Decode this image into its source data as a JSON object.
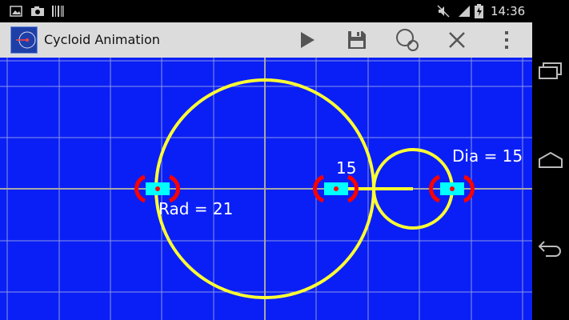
{
  "status_bar": {
    "time": "14:36",
    "icons": [
      "image-icon",
      "camera-icon",
      "barcode-icon",
      "mute-icon",
      "signal-icon",
      "battery-charging-icon"
    ]
  },
  "action_bar": {
    "title": "Cycloid Animation",
    "actions": [
      "play-icon",
      "save-icon",
      "circles-icon",
      "close-icon",
      "overflow-menu-icon"
    ]
  },
  "canvas": {
    "background": "#0a1ff5",
    "circle_color": "#ffff33",
    "handle_color": "#00ffff",
    "marker_color": "#ff0000",
    "labels": {
      "radius": "Rad = 21",
      "diameter": "Dia = 15",
      "arm": "15"
    }
  },
  "nav_bar": {
    "buttons": [
      "recent-apps-icon",
      "home-icon",
      "back-icon"
    ]
  }
}
